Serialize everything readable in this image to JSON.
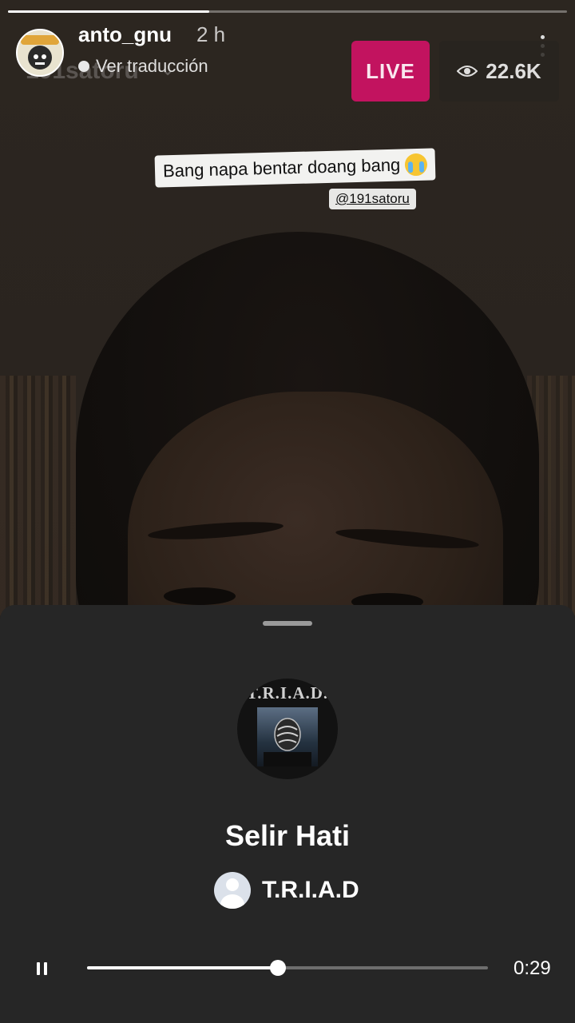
{
  "story": {
    "progress": 0.36,
    "username": "anto_gnu",
    "time_ago": "2 h",
    "translate_label": "Ver traducción",
    "ghost_username": "191satoru",
    "live_label": "LIVE",
    "viewer_count": "22.6K",
    "sticker_text": "Bang napa bentar doang bang",
    "mention": "@191satoru"
  },
  "music_sheet": {
    "album_label": "T.R.I.A.D.",
    "song_title": "Selir Hati",
    "artist": "T.R.I.A.D",
    "elapsed": "0:29",
    "playback_fraction": 0.477
  },
  "icons": {
    "more": "more-vertical-icon",
    "eye": "eye-icon",
    "pause": "pause-icon",
    "emoji": "crying-face-emoji"
  }
}
